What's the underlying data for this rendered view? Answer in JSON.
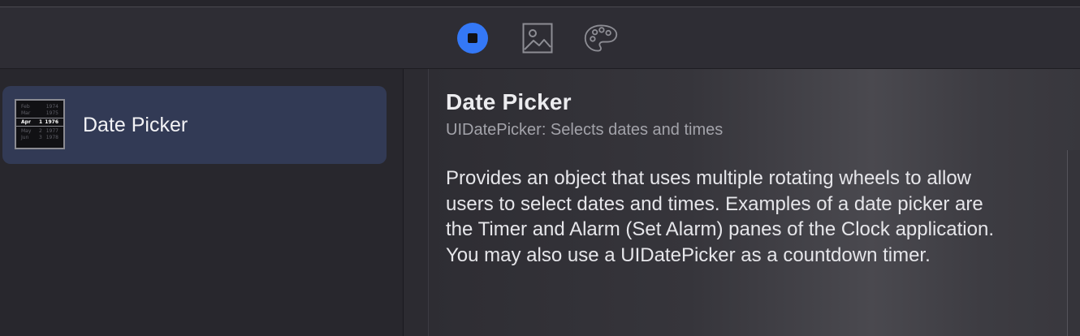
{
  "toolbar": {
    "buttons": [
      {
        "name": "objects",
        "icon": "stop-square-circle-icon",
        "selected": true
      },
      {
        "name": "media",
        "icon": "photo-icon",
        "selected": false
      },
      {
        "name": "colors",
        "icon": "palette-icon",
        "selected": false
      }
    ],
    "accent_color": "#3478f6"
  },
  "library": {
    "items": [
      {
        "label": "Date Picker",
        "selected": true,
        "thumbnail": {
          "rows": [
            {
              "month": "Feb",
              "day": "",
              "year": "1974"
            },
            {
              "month": "Mar",
              "day": "",
              "year": "1975"
            },
            {
              "month": "Apr",
              "day": "1",
              "year": "1976"
            },
            {
              "month": "May",
              "day": "2",
              "year": "1977"
            },
            {
              "month": "Jun",
              "day": "3",
              "year": "1978"
            }
          ]
        }
      }
    ]
  },
  "detail": {
    "title": "Date Picker",
    "subtitle": "UIDatePicker: Selects dates and times",
    "description": "Provides an object that uses multiple rotating wheels to allow users to select dates and times. Examples of a date picker are the Timer and Alarm (Set Alarm) panes of the Clock application. You may also use a UIDatePicker as a countdown timer."
  }
}
